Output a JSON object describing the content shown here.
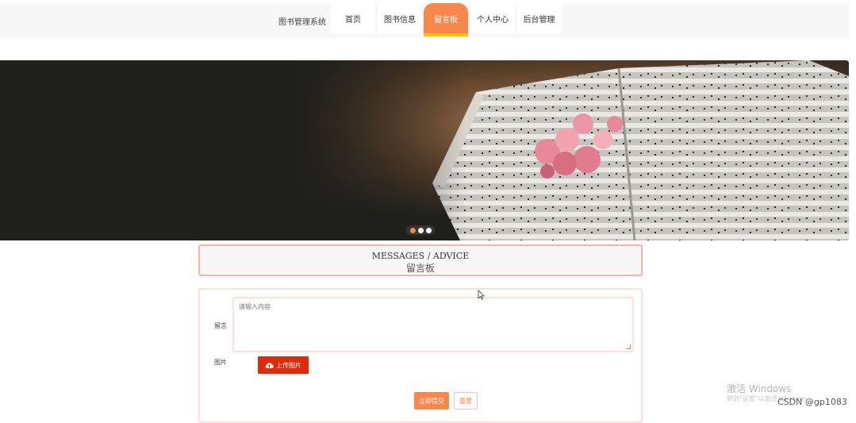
{
  "nav": {
    "brand": "图书管理系统",
    "items": [
      {
        "label": "首页",
        "active": false
      },
      {
        "label": "图书信息",
        "active": false
      },
      {
        "label": "留言板",
        "active": true
      },
      {
        "label": "个人中心",
        "active": false
      },
      {
        "label": "后台管理",
        "active": false
      }
    ]
  },
  "carousel": {
    "image": "open-music-score-with-pink-flowers",
    "slides": 3,
    "active_slide": 1
  },
  "section": {
    "title_en": "MESSAGES / ADVICE",
    "title_cn": "留言板"
  },
  "form": {
    "message_label": "留言",
    "message_placeholder": "请输入内容",
    "image_label": "图片",
    "upload_label": "上传图片",
    "upload_icon": "cloud-upload-icon",
    "submit_label": "立即提交",
    "reset_label": "重置"
  },
  "watermark": {
    "activate_title": "激活 Windows",
    "activate_sub": "转到\"设置\"以激活 Windows",
    "csdn": "CSDN @gp1083"
  },
  "colors": {
    "accent": "#f7874a",
    "active_underline": "#f5c400",
    "upload_button": "#e02a0a",
    "border": "#f5b5a7"
  }
}
